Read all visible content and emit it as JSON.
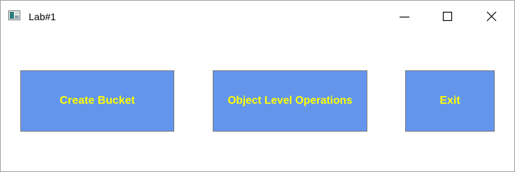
{
  "window": {
    "title": "Lab#1",
    "icon": "application-icon",
    "controls": {
      "minimize_icon": "minimize-icon",
      "maximize_icon": "maximize-icon",
      "close_icon": "close-icon"
    }
  },
  "buttons": {
    "create_bucket": "Create Bucket",
    "object_ops": "Object Level Operations",
    "exit": "Exit"
  },
  "colors": {
    "button_background": "#6495ED",
    "button_text": "#FFFF00",
    "window_background": "#FFFFFF"
  }
}
